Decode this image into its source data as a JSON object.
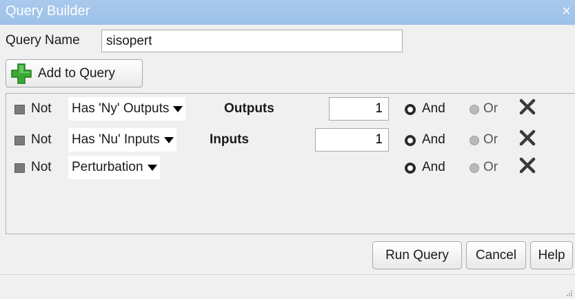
{
  "window": {
    "title": "Query Builder",
    "close_symbol": "×"
  },
  "query_name": {
    "label": "Query Name",
    "value": "sisopert"
  },
  "add_button": {
    "label": "Add to Query",
    "icon": "green-plus-icon"
  },
  "criteria": [
    {
      "not_label": "Not",
      "not_checked": false,
      "condition": "Has 'Ny' Outputs",
      "unit_label": "Outputs",
      "value": "1",
      "and_label": "And",
      "or_label": "Or",
      "logic": "And"
    },
    {
      "not_label": "Not",
      "not_checked": false,
      "condition": "Has 'Nu' Inputs",
      "unit_label": "Inputs",
      "value": "1",
      "and_label": "And",
      "or_label": "Or",
      "logic": "And"
    },
    {
      "not_label": "Not",
      "not_checked": false,
      "condition": "Perturbation",
      "and_label": "And",
      "or_label": "Or",
      "logic": "And"
    }
  ],
  "footer": {
    "run_label": "Run Query",
    "cancel_label": "Cancel",
    "help_label": "Help"
  },
  "colors": {
    "titlebar": "#a9c9ec",
    "plus_green": "#3aa935",
    "background": "#f0f0f0"
  }
}
